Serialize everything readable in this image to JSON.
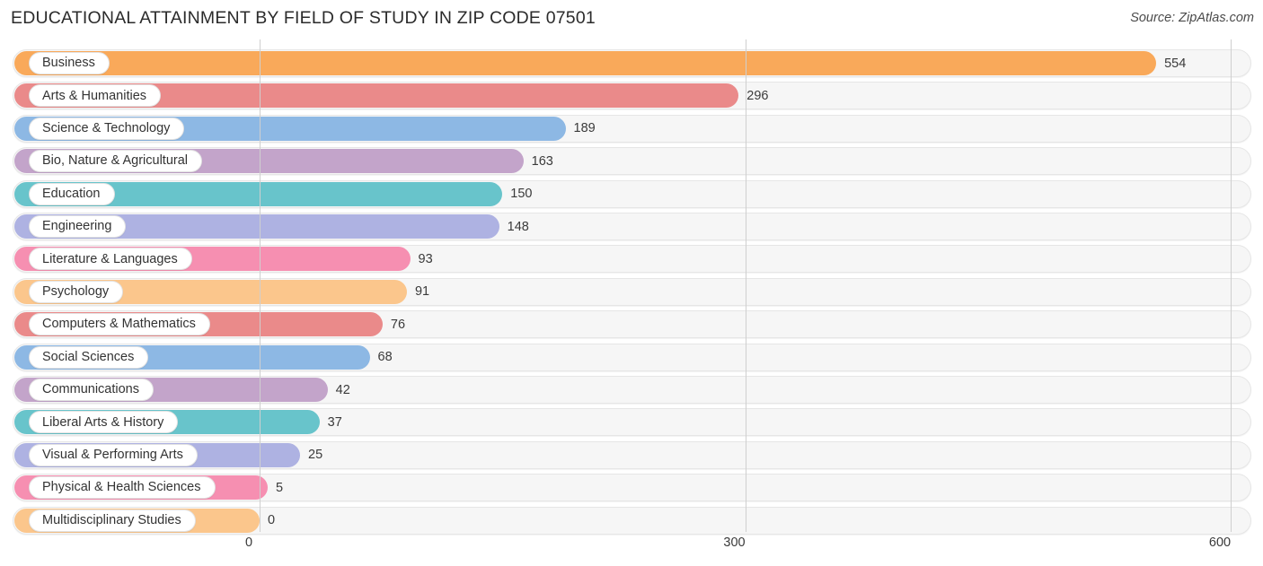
{
  "header": {
    "title": "EDUCATIONAL ATTAINMENT BY FIELD OF STUDY IN ZIP CODE 07501",
    "source": "Source: ZipAtlas.com"
  },
  "chart_data": {
    "type": "bar",
    "orientation": "horizontal",
    "title": "EDUCATIONAL ATTAINMENT BY FIELD OF STUDY IN ZIP CODE 07501",
    "subtitle": "",
    "xlabel": "",
    "ylabel": "",
    "xlim": [
      0,
      600
    ],
    "ylim": null,
    "grid": true,
    "legend": null,
    "xticks": [
      "0",
      "300",
      "600"
    ],
    "xtick_values": [
      0,
      300,
      600
    ],
    "categories": [
      "Business",
      "Arts & Humanities",
      "Science & Technology",
      "Bio, Nature & Agricultural",
      "Education",
      "Engineering",
      "Literature & Languages",
      "Psychology",
      "Computers & Mathematics",
      "Social Sciences",
      "Communications",
      "Liberal Arts & History",
      "Visual & Performing Arts",
      "Physical & Health Sciences",
      "Multidisciplinary Studies"
    ],
    "values": [
      554,
      296,
      189,
      163,
      150,
      148,
      93,
      91,
      76,
      68,
      42,
      37,
      25,
      5,
      0
    ],
    "value_labels": [
      "554",
      "296",
      "189",
      "163",
      "150",
      "148",
      "93",
      "91",
      "76",
      "68",
      "42",
      "37",
      "25",
      "5",
      "0"
    ],
    "colors": [
      "#f9a95a",
      "#ea8a8a",
      "#8db8e4",
      "#c3a4ca",
      "#68c4cb",
      "#aeb2e2",
      "#f68fb1",
      "#fbc68c",
      "#ea8a8a",
      "#8db8e4",
      "#c3a4ca",
      "#68c4cb",
      "#aeb2e2",
      "#f68fb1",
      "#fbc68c"
    ]
  },
  "axis": {
    "ticks": [
      "0",
      "300",
      "600"
    ]
  }
}
